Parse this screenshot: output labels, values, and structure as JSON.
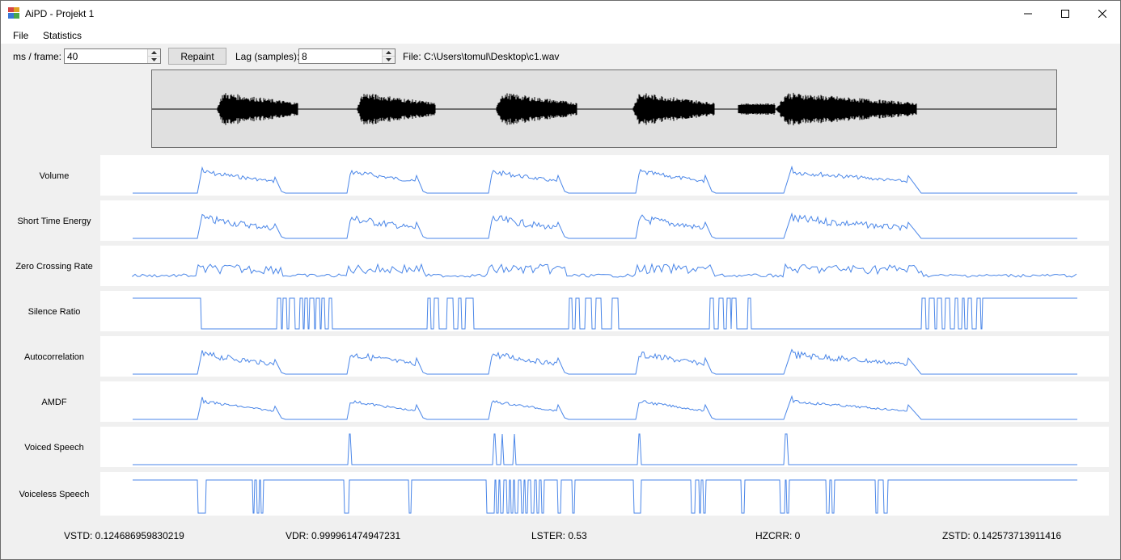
{
  "window": {
    "title": "AiPD - Projekt 1"
  },
  "menu": {
    "file": "File",
    "statistics": "Statistics"
  },
  "toolbar": {
    "ms_label": "ms / frame:",
    "ms_value": "40",
    "repaint_label": "Repaint",
    "lag_label": "Lag (samples):",
    "lag_value": "8",
    "file_label": "File: C:\\Users\\tomul\\Desktop\\c1.wav"
  },
  "graphs": [
    {
      "label": "Volume"
    },
    {
      "label": "Short Time Energy"
    },
    {
      "label": "Zero Crossing Rate"
    },
    {
      "label": "Silence Ratio"
    },
    {
      "label": "Autocorrelation"
    },
    {
      "label": "AMDF"
    },
    {
      "label": "Voiced Speech"
    },
    {
      "label": "Voiceless Speech"
    }
  ],
  "stats": {
    "vstd": "VSTD: 0.124686959830219",
    "vdr": "VDR: 0.999961474947231",
    "lster": "LSTER: 0.53",
    "hzcrr": "HZCRR: 0",
    "zstd": "ZSTD: 0.142573713911416"
  },
  "colors": {
    "signal": "#4a86e8",
    "waveform": "#000000"
  }
}
